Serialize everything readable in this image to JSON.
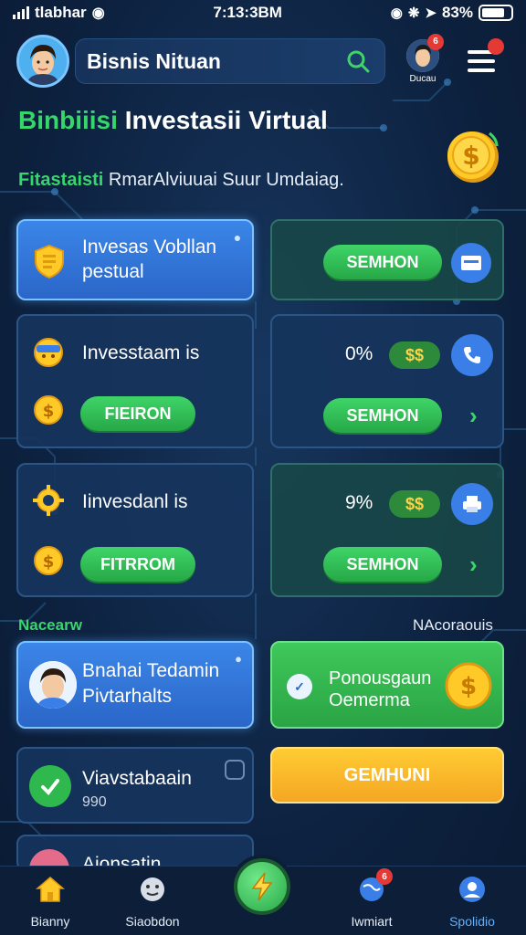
{
  "status_bar": {
    "carrier": "tlabhar",
    "time": "7:13:3BM",
    "battery": "83%"
  },
  "header": {
    "title": "Bisnis Nituan",
    "profile_name": "Ducau",
    "profile_badge": "6"
  },
  "headline": {
    "green_part": "Binbiiisi",
    "white_part": "Investasii Virtual"
  },
  "subline": {
    "green_part": "Fitastaisti",
    "white_part": "RmarAlviuuai Suur Umdaiag."
  },
  "cards": {
    "promo": {
      "text_line1": "Invesas Vobllan",
      "text_line2": "pestual"
    },
    "top_right": {
      "button": "SEMHON"
    },
    "invest1": {
      "title": "Invesstaam is",
      "button": "FIEIRON"
    },
    "invest1_right": {
      "percent": "0%",
      "dollar": "$$",
      "button": "SEMHON"
    },
    "invest2": {
      "title": "Iinvesdanl is",
      "button": "FITRROM"
    },
    "invest2_right": {
      "percent": "9%",
      "dollar": "$$",
      "button": "SEMHON"
    }
  },
  "section": {
    "left_label": "Nacearw",
    "right_label": "NAcoraouis"
  },
  "lower": {
    "profile_card": {
      "line1": "Bnahai Tedamin",
      "line2": "Pivtarhalts"
    },
    "green_card": {
      "line1": "Ponousgaun",
      "line2": "Oemerma"
    },
    "check_card": {
      "title": "Viavstabaain",
      "value": "990"
    },
    "yellow_button": "GEMHUNI",
    "partial_card": "Aionsatin"
  },
  "bottom_nav": {
    "items": [
      {
        "label": "Bianny"
      },
      {
        "label": "Siaobdon"
      },
      {
        "label": "Iwmiart",
        "badge": "6"
      },
      {
        "label": "Spolidio"
      }
    ]
  },
  "colors": {
    "background": "#0d2240",
    "accent_green": "#37d66b",
    "card_blue": "#3b86e8",
    "button_yellow": "#f5a623"
  }
}
